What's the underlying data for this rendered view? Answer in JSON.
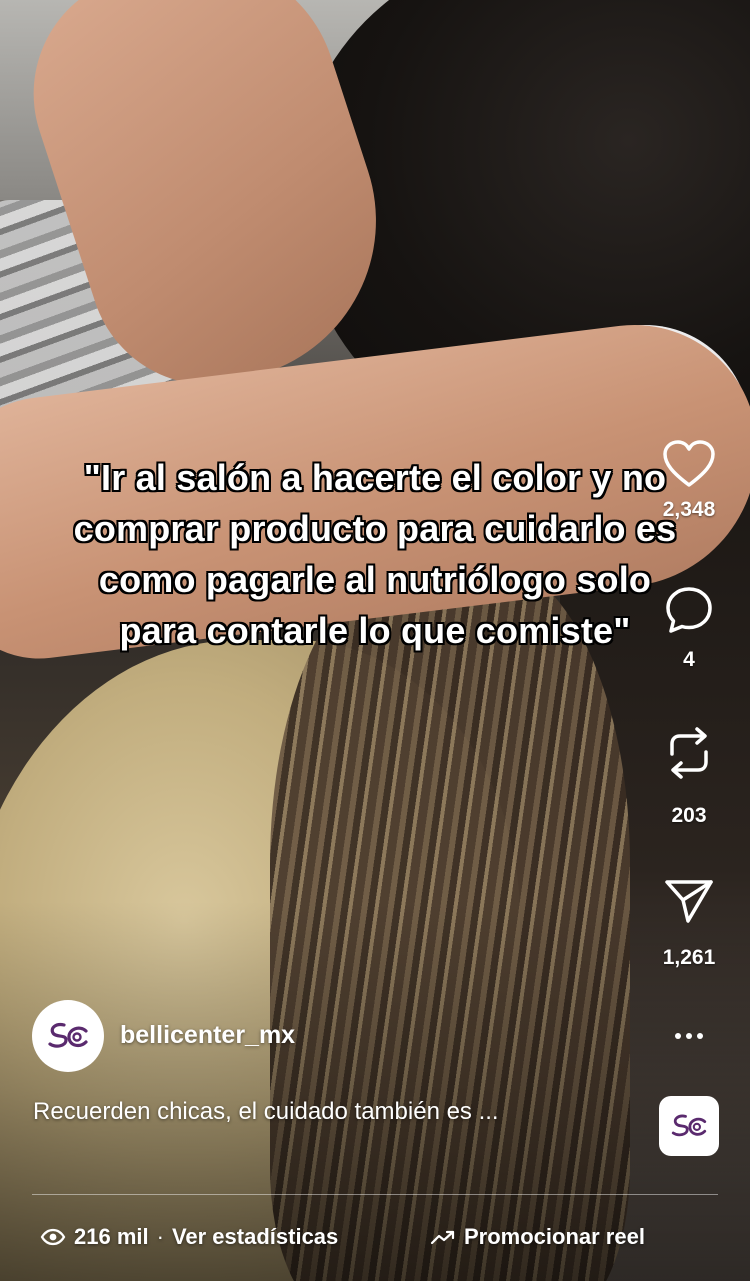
{
  "overlay": {
    "quote": "\"Ir al salón a hacerte el color y no\ncomprar producto para cuidarlo es\ncomo pagarle al nutriólogo solo\npara contarle lo que comiste\""
  },
  "actions": {
    "likes": "2,348",
    "comments": "4",
    "reposts": "203",
    "shares": "1,261"
  },
  "post": {
    "username": "bellicenter_mx",
    "caption": "Recuerden chicas, el cuidado también es ..."
  },
  "footer": {
    "views": "216 mil",
    "separator": "·",
    "stats_label": "Ver estadísticas",
    "promote_label": "Promocionar reel"
  },
  "icons": {
    "like": "heart-icon",
    "comment": "comment-bubble-icon",
    "repost": "repost-icon",
    "share": "paper-plane-icon",
    "more": "more-dots-icon",
    "views": "eye-icon",
    "promote": "trending-up-icon"
  },
  "colors": {
    "text": "#ffffff",
    "brand": "#5a2a6e"
  }
}
